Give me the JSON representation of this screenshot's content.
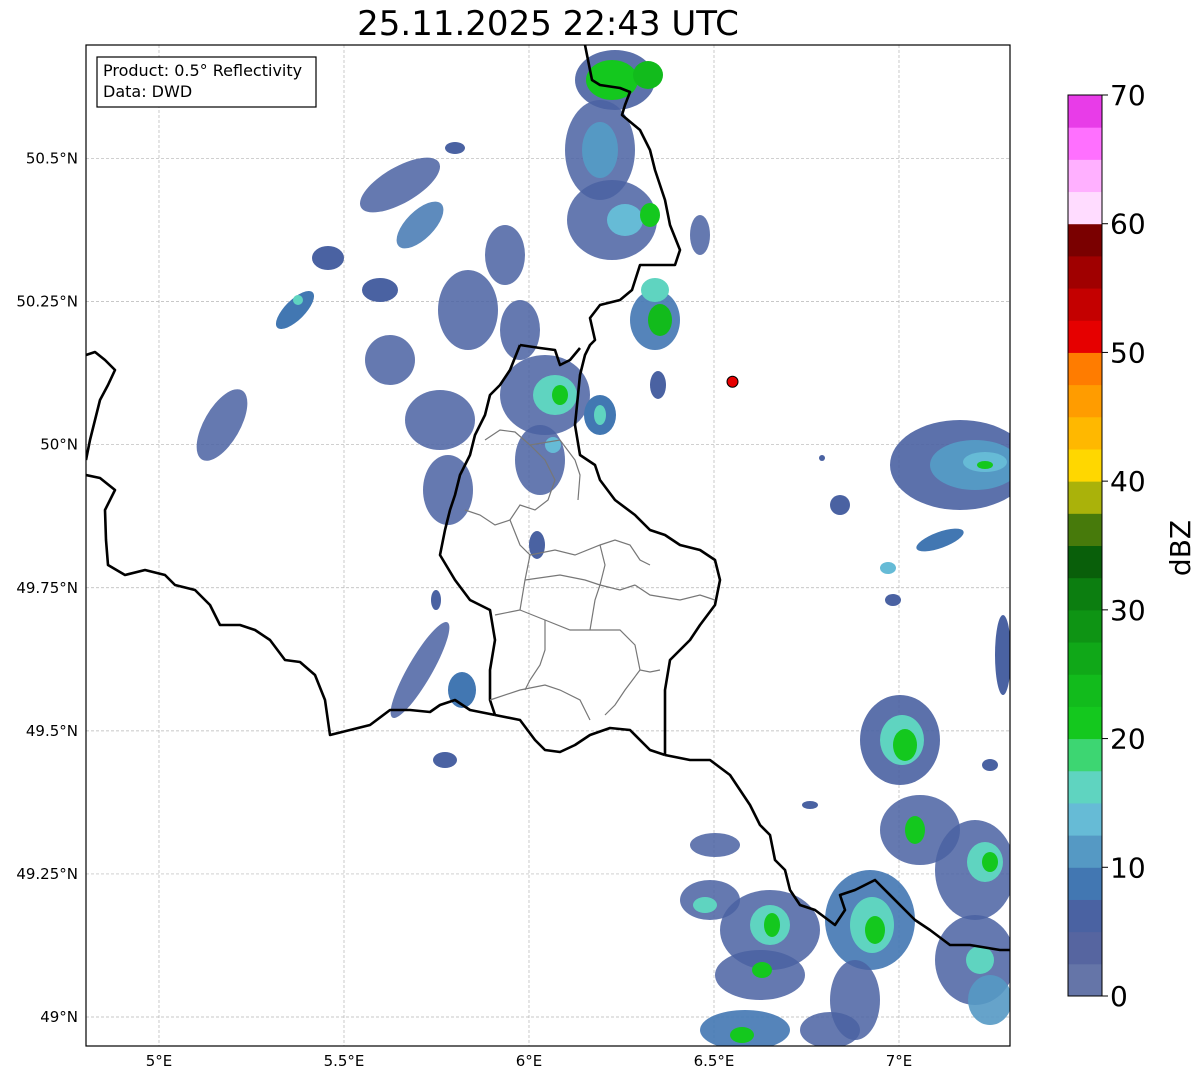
{
  "title": "25.11.2025 22:43 UTC",
  "info_box": {
    "line1": "Product: 0.5° Reflectivity",
    "line2": "Data: DWD"
  },
  "map": {
    "lon_range": [
      4.8,
      7.3
    ],
    "lat_range": [
      48.95,
      50.7
    ],
    "lon_ticks": [
      {
        "value": 5.0,
        "label": "5°E"
      },
      {
        "value": 5.5,
        "label": "5.5°E"
      },
      {
        "value": 6.0,
        "label": "6°E"
      },
      {
        "value": 6.5,
        "label": "6.5°E"
      },
      {
        "value": 7.0,
        "label": "7°E"
      }
    ],
    "lat_ticks": [
      {
        "value": 49.0,
        "label": "49°N"
      },
      {
        "value": 49.25,
        "label": "49.25°N"
      },
      {
        "value": 49.5,
        "label": "49.5°N"
      },
      {
        "value": 49.75,
        "label": "49.75°N"
      },
      {
        "value": 50.0,
        "label": "50°N"
      },
      {
        "value": 50.25,
        "label": "50.25°N"
      },
      {
        "value": 50.5,
        "label": "50.5°N"
      }
    ],
    "grid": true,
    "radar_site": {
      "lon": 6.55,
      "lat": 50.11,
      "color": "#e60000"
    }
  },
  "colorbar": {
    "label": "dBZ",
    "range": [
      0,
      70
    ],
    "ticks": [
      {
        "value": 0,
        "label": "0"
      },
      {
        "value": 10,
        "label": "10"
      },
      {
        "value": 20,
        "label": "20"
      },
      {
        "value": 30,
        "label": "30"
      },
      {
        "value": 40,
        "label": "40"
      },
      {
        "value": 50,
        "label": "50"
      },
      {
        "value": 60,
        "label": "60"
      },
      {
        "value": 70,
        "label": "70"
      }
    ],
    "colors": [
      "#6575a8",
      "#5665a0",
      "#4a62a2",
      "#4277b2",
      "#5599c4",
      "#66bbd6",
      "#5fd4c0",
      "#3dd672",
      "#14c81e",
      "#12bb1c",
      "#10a818",
      "#0e9414",
      "#0c7e10",
      "#095f0a",
      "#477a0b",
      "#aab20a",
      "#ffd700",
      "#ffb800",
      "#ff9c00",
      "#ff7c00",
      "#e60000",
      "#c40000",
      "#a00000",
      "#7a0000",
      "#ffdcff",
      "#ffb0ff",
      "#ff70ff",
      "#e83ce8"
    ]
  }
}
